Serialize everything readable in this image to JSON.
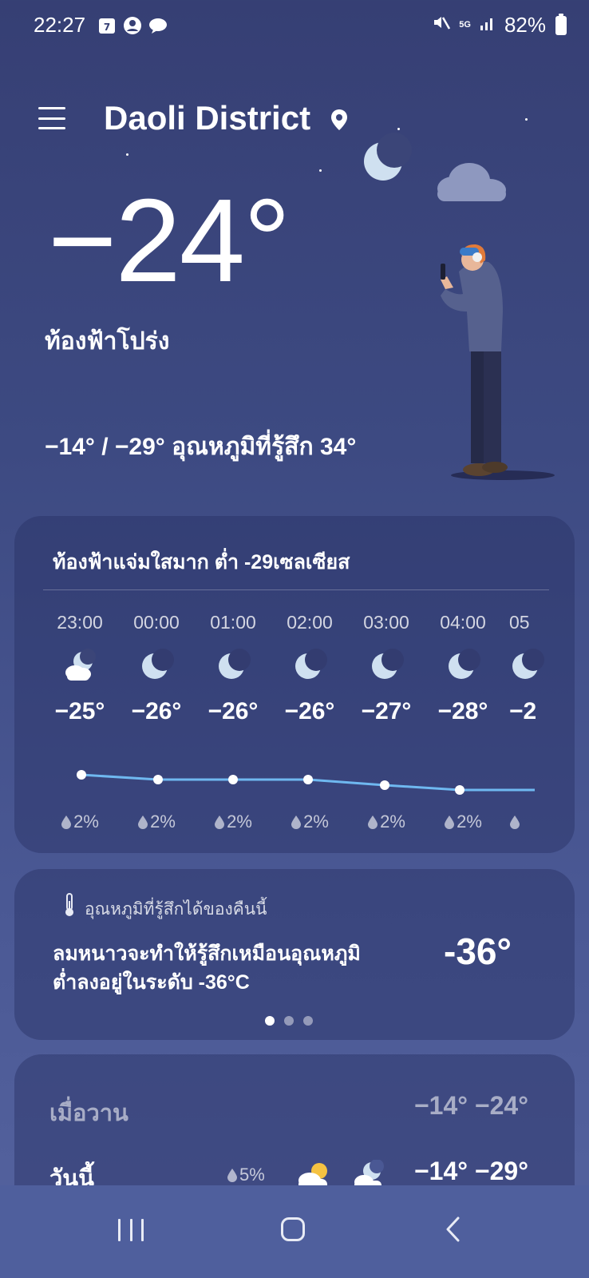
{
  "status_bar": {
    "time": "22:27",
    "calendar_day": "7",
    "battery": "82%",
    "network": "5G"
  },
  "header": {
    "location": "Daoli District"
  },
  "current": {
    "temperature": "−24°",
    "condition": "ท้องฟ้าโปร่ง",
    "high_low_feels": "−14° / −29° อุณหภูมิที่รู้สึก 34°"
  },
  "hourly": {
    "title": "ท้องฟ้าแจ่มใสมาก ต่ำ -29เซลเซียส",
    "items": [
      {
        "time": "23:00",
        "temp": "−25°",
        "precip": "2%",
        "icon": "partly-cloudy-night-icon"
      },
      {
        "time": "00:00",
        "temp": "−26°",
        "precip": "2%",
        "icon": "moon-icon"
      },
      {
        "time": "01:00",
        "temp": "−26°",
        "precip": "2%",
        "icon": "moon-icon"
      },
      {
        "time": "02:00",
        "temp": "−26°",
        "precip": "2%",
        "icon": "moon-icon"
      },
      {
        "time": "03:00",
        "temp": "−27°",
        "precip": "2%",
        "icon": "moon-icon"
      },
      {
        "time": "04:00",
        "temp": "−28°",
        "precip": "2%",
        "icon": "moon-icon"
      },
      {
        "time": "05",
        "temp": "−2",
        "precip": "",
        "icon": "moon-icon"
      }
    ]
  },
  "feels_like": {
    "label": "อุณหภูมิที่รู้สึกได้ของคืนนี้",
    "line1": "ลมหนาวจะทำให้รู้สึกเหมือนอุณหภูมิ",
    "line2": "ต่ำลงอยู่ในระดับ -36°C",
    "temp": "-36°"
  },
  "daily": {
    "yesterday": {
      "label": "เมื่อวาน",
      "temps": "−14° −24°"
    },
    "today": {
      "label": "วันนี้",
      "precip": "5%",
      "temps": "−14° −29°"
    }
  },
  "colors": {
    "bg_top": "#363f74",
    "bg_bottom": "#55639f",
    "trend_line": "#6fb8f0",
    "moon": "#cfe0f0"
  }
}
